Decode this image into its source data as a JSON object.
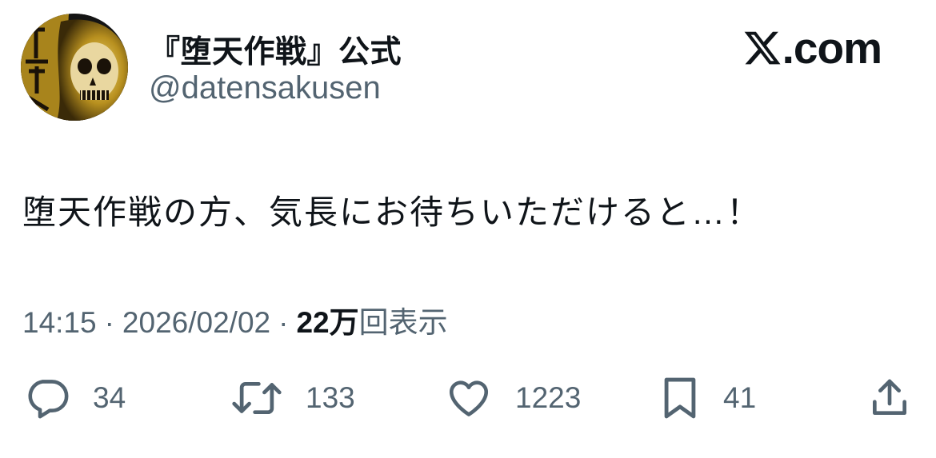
{
  "author": {
    "display_name": "『堕天作戦』公式",
    "handle": "@datensakusen"
  },
  "brand": {
    "text": ".com"
  },
  "tweet": {
    "text": "堕天作戦の方、気長にお待ちいただけると…！"
  },
  "meta": {
    "time": "14:15",
    "date": "2026/02/02",
    "views_count": "22万",
    "views_label": "回表示",
    "separator": "·"
  },
  "actions": {
    "replies": "34",
    "reposts": "133",
    "likes": "1223",
    "bookmarks": "41"
  },
  "colors": {
    "text_primary": "#0f1419",
    "text_secondary": "#536471",
    "background": "#ffffff",
    "avatar_gold": "#c9a227"
  },
  "icons": {
    "reply": "speech-bubble-icon",
    "repost": "repost-arrows-icon",
    "like": "heart-icon",
    "bookmark": "bookmark-icon",
    "share": "share-upload-icon",
    "brand": "x-logo-icon"
  }
}
